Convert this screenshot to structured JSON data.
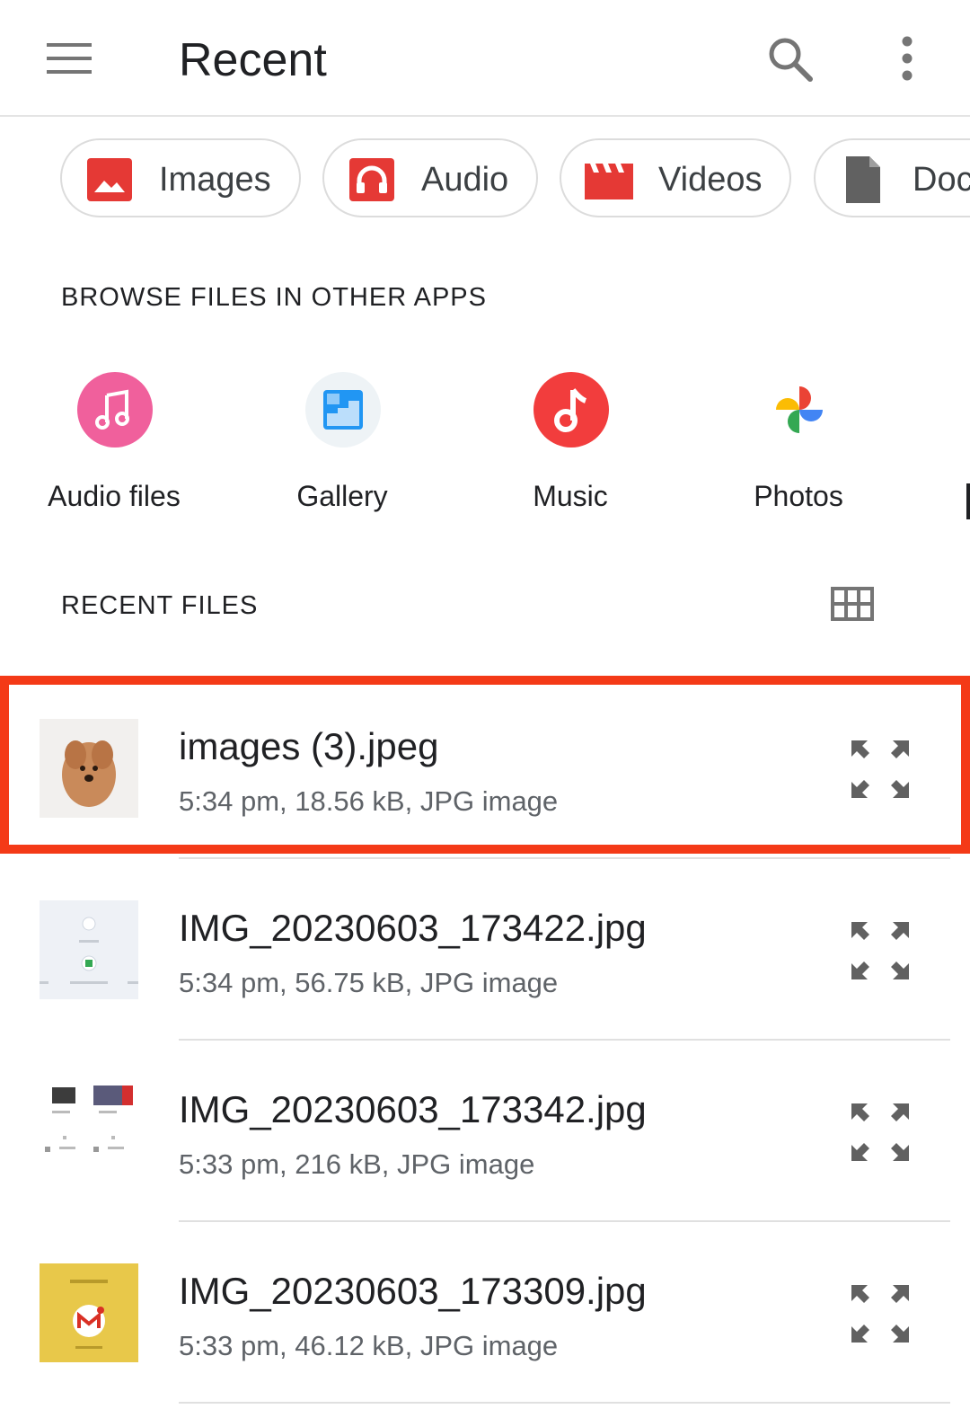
{
  "header": {
    "title": "Recent"
  },
  "chips": [
    {
      "label": "Images",
      "icon": "image-icon",
      "color": "#e53935"
    },
    {
      "label": "Audio",
      "icon": "headphones-icon",
      "color": "#e53935"
    },
    {
      "label": "Videos",
      "icon": "clapperboard-icon",
      "color": "#e53935"
    },
    {
      "label": "Doc",
      "icon": "document-icon",
      "color": "#616161"
    }
  ],
  "browse_section": {
    "title": "BROWSE FILES IN OTHER APPS",
    "apps": [
      {
        "label": "Audio files",
        "icon": "music-note-icon",
        "color": "#f0609c"
      },
      {
        "label": "Gallery",
        "icon": "gallery-icon",
        "color": "#2196f3"
      },
      {
        "label": "Music",
        "icon": "music-app-icon",
        "color": "#f23d3d"
      },
      {
        "label": "Photos",
        "icon": "pinwheel-icon",
        "color": "#fbbc04"
      }
    ]
  },
  "recent_section": {
    "title": "RECENT FILES",
    "view_toggle_icon": "grid-view-icon"
  },
  "files": [
    {
      "name": "images (3).jpeg",
      "meta": "5:34 pm, 18.56 kB, JPG image",
      "thumb": "puppy-photo",
      "highlighted": true
    },
    {
      "name": "IMG_20230603_173422.jpg",
      "meta": "5:34 pm, 56.75 kB, JPG image",
      "thumb": "upload-screenshot"
    },
    {
      "name": "IMG_20230603_173342.jpg",
      "meta": "5:33 pm, 216 kB, JPG image",
      "thumb": "files-screenshot"
    },
    {
      "name": "IMG_20230603_173309.jpg",
      "meta": "5:33 pm, 46.12 kB, JPG image",
      "thumb": "gmail-screenshot"
    }
  ],
  "colors": {
    "highlight_border": "#f43a17",
    "icon_gray": "#757575"
  }
}
